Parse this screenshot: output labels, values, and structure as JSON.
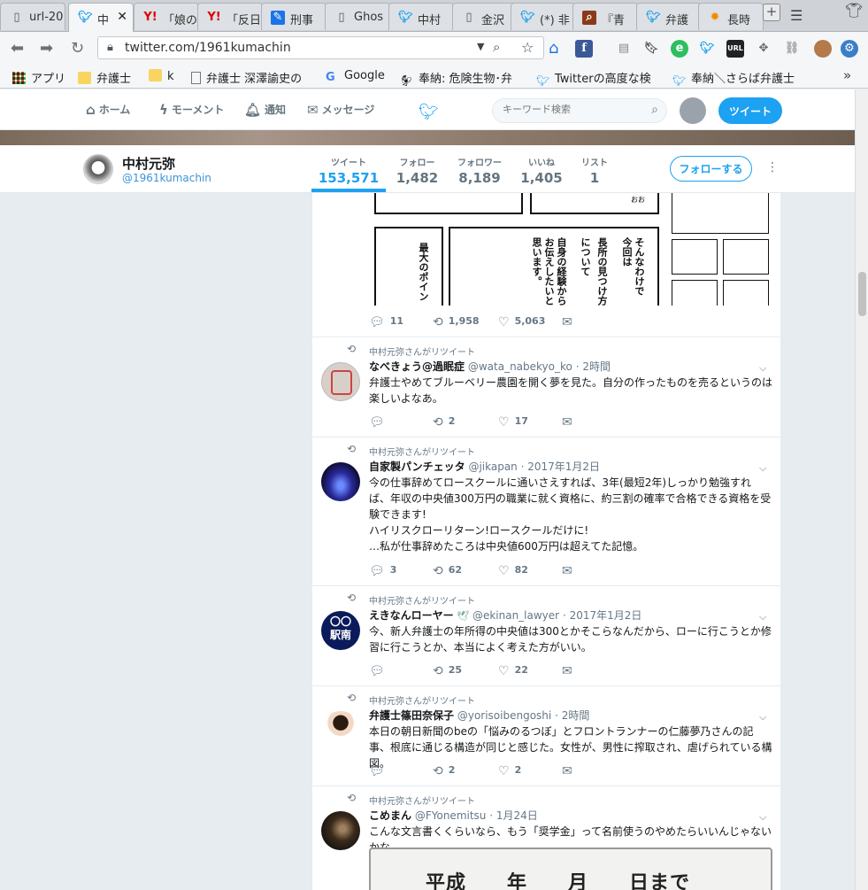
{
  "browser": {
    "tabs": [
      {
        "label": "url-20",
        "icon": "page-icon"
      },
      {
        "label": "中",
        "icon": "twitter-bird-icon",
        "active": true
      },
      {
        "label": "「娘の",
        "icon": "yahoo-icon"
      },
      {
        "label": "「反日",
        "icon": "yahoo-icon"
      },
      {
        "label": "刑事",
        "icon": "blue-pen-icon"
      },
      {
        "label": "Ghos",
        "icon": "page-icon"
      },
      {
        "label": "中村",
        "icon": "twitter-bird-icon"
      },
      {
        "label": "金沢",
        "icon": "page-icon"
      },
      {
        "label": "(*) 非",
        "icon": "twitter-bird-icon"
      },
      {
        "label": "『青",
        "icon": "search-magnifier-icon"
      },
      {
        "label": "弁護",
        "icon": "twitter-bird-icon"
      },
      {
        "label": "長時",
        "icon": "sun-icon"
      }
    ],
    "url": "twitter.com/1961kumachin",
    "bookmarks": [
      {
        "label": "アプリ",
        "icon": "apps-grid-icon"
      },
      {
        "label": "弁護士",
        "icon": "folder-icon"
      },
      {
        "label": "k",
        "icon": "folder-icon"
      },
      {
        "label": "弁護士 深澤諭史の",
        "icon": "page-icon"
      },
      {
        "label": "Google",
        "icon": "google-icon"
      },
      {
        "label": "奉納: 危険生物･弁",
        "icon": "bird-icon"
      },
      {
        "label": "Twitterの高度な検",
        "icon": "twitter-bird-icon"
      },
      {
        "label": "奉納＼さらば弁護士",
        "icon": "twitter-bird-icon"
      }
    ],
    "colors": {
      "twitter_blue": "#1da1f2",
      "background": "#e6ecf0"
    }
  },
  "twitter_nav": {
    "home": "ホーム",
    "moments": "モーメント",
    "notifications": "通知",
    "messages": "メッセージ",
    "search_placeholder": "キーワード検索",
    "tweet_button": "ツイート"
  },
  "profile": {
    "name": "中村元弥",
    "handle": "@1961kumachin",
    "stats": [
      {
        "label": "ツイート",
        "value": "153,571",
        "active": true
      },
      {
        "label": "フォロー",
        "value": "1,482"
      },
      {
        "label": "フォロワー",
        "value": "8,189"
      },
      {
        "label": "いいね",
        "value": "1,405"
      },
      {
        "label": "リスト",
        "value": "1"
      }
    ],
    "follow_button": "フォローする"
  },
  "first_tweet": {
    "manga_text": [
      "そんなわけで",
      "今回は",
      "長所の見つけ方",
      "について",
      "自身の経験から",
      "お伝えしたいと",
      "思います。",
      "最大のポイン"
    ],
    "manga_small": "おお",
    "actions": {
      "replies": "11",
      "retweets": "1,958",
      "likes": "5,063"
    }
  },
  "tweets": [
    {
      "retweeted_by": "中村元弥さんがリツイート",
      "name": "なべきょう@過眠症",
      "handle": "@wata_nabekyo_ko",
      "time": "· 2時間",
      "lines": [
        "弁護士やめてブルーベリー農園を開く夢を見た。自分の作ったものを売るというのは楽しいよなあ。"
      ],
      "replies": "",
      "retweets": "2",
      "likes": "17"
    },
    {
      "retweeted_by": "中村元弥さんがリツイート",
      "name": "自家製パンチェッタ",
      "handle": "@jikapan",
      "time": "· 2017年1月2日",
      "lines": [
        "今の仕事辞めてロースクールに通いさえすれば、3年(最短2年)しっかり勉強すれば、年収の中央値300万円の職業に就く資格に、約三割の確率で合格できる資格を受験できます!",
        "ハイリスクローリターン!ロースクールだけに!",
        "…私が仕事辞めたころは中央値600万円は超えてた記憶。"
      ],
      "replies": "3",
      "retweets": "62",
      "likes": "82"
    },
    {
      "retweeted_by": "中村元弥さんがリツイート",
      "name": "えきなんローヤー",
      "handle": "@ekinan_lawyer",
      "time": "· 2017年1月2日",
      "avatar_text_top": "〇〇",
      "avatar_text_bottom": "駅南",
      "lines": [
        "今、新人弁護士の年所得の中央値は300とかそこらなんだから、ローに行こうとか修習に行こうとか、本当によく考えた方がいい。"
      ],
      "replies": "",
      "retweets": "25",
      "likes": "22"
    },
    {
      "retweeted_by": "中村元弥さんがリツイート",
      "name": "弁護士篠田奈保子",
      "handle": "@yorisoibengoshi",
      "time": "· 2時間",
      "lines": [
        "本日の朝日新聞のbeの「悩みのるつぼ」とフロントランナーの仁藤夢乃さんの記事、根底に通じる構造が同じと感じた。女性が、男性に搾取され、虐げられている構図。"
      ],
      "replies": "",
      "retweets": "2",
      "likes": "2"
    },
    {
      "retweeted_by": "中村元弥さんがリツイート",
      "name": "こめまん",
      "handle": "@FYonemitsu",
      "time": "· 1月24日",
      "lines": [
        "こんな文言書くくらいなら、もう「奨学金」って名前使うのやめたらいいんじゃないかな"
      ],
      "image_text": "平成＿＿年＿＿月＿＿日まで"
    }
  ]
}
